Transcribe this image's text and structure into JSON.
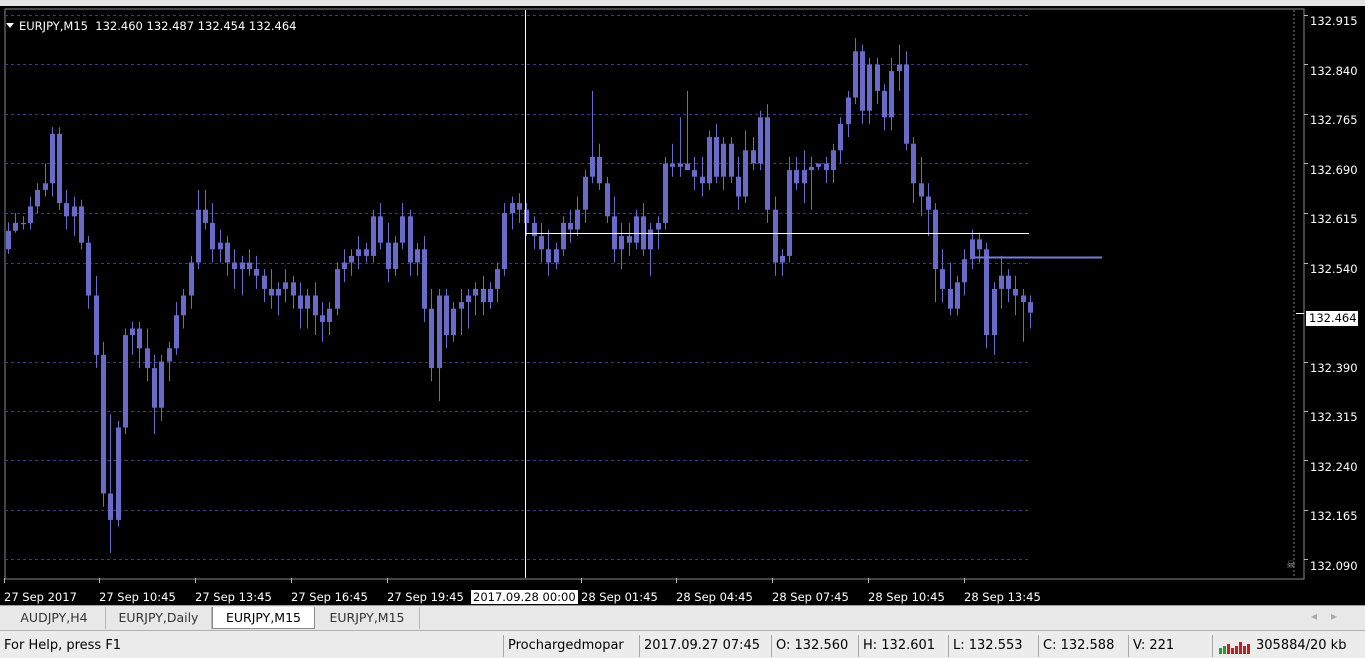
{
  "chart_header": {
    "symbol": "EURJPY,M15",
    "ohlc": "132.460 132.487 132.454 132.464"
  },
  "price_axis": [
    "132.915",
    "132.840",
    "132.765",
    "132.690",
    "132.615",
    "132.540",
    "132.464",
    "132.390",
    "132.315",
    "132.240",
    "132.165",
    "132.090"
  ],
  "current_price_label": "132.464",
  "time_axis": [
    "27 Sep 2017",
    "27 Sep 10:45",
    "27 Sep 13:45",
    "27 Sep 16:45",
    "27 Sep 19:45",
    "28 Sep 01:45",
    "28 Sep 04:45",
    "28 Sep 07:45",
    "28 Sep 10:45",
    "28 Sep 13:45"
  ],
  "crosshair_date": "2017.09.28 00:00",
  "tabs": [
    {
      "label": "AUDJPY,H4",
      "active": false
    },
    {
      "label": "EURJPY,Daily",
      "active": false
    },
    {
      "label": "EURJPY,M15",
      "active": true
    },
    {
      "label": "EURJPY,M15",
      "active": false
    }
  ],
  "status": {
    "help": "For Help, press F1",
    "profile": "Prochargedmopar",
    "datetime": "2017.09.27 07:45",
    "open": "O: 132.560",
    "high": "H: 132.601",
    "low": "L: 132.553",
    "close": "C: 132.588",
    "volume": "V: 221",
    "traffic": "305884/20 kb"
  },
  "colors": {
    "background": "#000000",
    "bull": "#6a6ac8",
    "bear": "#6a6ac8",
    "doji": "#22cc22",
    "grid": "#3a3a8a",
    "crosshair": "#ffffff",
    "price_line": "#7a7ad8"
  },
  "chart_data": {
    "type": "candlestick",
    "symbol": "EURJPY",
    "timeframe": "M15",
    "ylim": [
      132.075,
      132.925
    ],
    "grid": true,
    "y_ticks": [
      132.915,
      132.84,
      132.765,
      132.69,
      132.615,
      132.54,
      132.464,
      132.39,
      132.315,
      132.24,
      132.165,
      132.09
    ],
    "x_ticks": [
      "27 Sep 2017",
      "27 Sep 10:45",
      "27 Sep 13:45",
      "27 Sep 16:45",
      "27 Sep 19:45",
      "28 Sep 01:45",
      "28 Sep 04:45",
      "28 Sep 07:45",
      "28 Sep 10:45",
      "28 Sep 13:45"
    ],
    "last_price": 132.464,
    "horizontal_levels": [
      132.584,
      132.548
    ],
    "ohlc": [
      [
        132.56,
        132.601,
        132.553,
        132.588
      ],
      [
        132.588,
        132.615,
        132.585,
        132.6
      ],
      [
        132.6,
        132.61,
        132.59,
        132.598
      ],
      [
        132.6,
        132.64,
        132.59,
        132.625
      ],
      [
        132.625,
        132.66,
        132.615,
        132.65
      ],
      [
        132.65,
        132.69,
        132.64,
        132.66
      ],
      [
        132.66,
        132.745,
        132.64,
        132.735
      ],
      [
        132.735,
        132.745,
        132.62,
        132.63
      ],
      [
        132.63,
        132.65,
        132.59,
        132.61
      ],
      [
        132.61,
        132.64,
        132.58,
        132.625
      ],
      [
        132.625,
        132.635,
        132.56,
        132.57
      ],
      [
        132.57,
        132.58,
        132.47,
        132.49
      ],
      [
        132.49,
        132.52,
        132.38,
        132.4
      ],
      [
        132.4,
        132.42,
        132.17,
        132.19
      ],
      [
        132.19,
        132.31,
        132.1,
        132.15
      ],
      [
        132.15,
        132.3,
        132.14,
        132.29
      ],
      [
        132.29,
        132.44,
        132.28,
        132.43
      ],
      [
        132.43,
        132.45,
        132.4,
        132.44
      ],
      [
        132.44,
        132.45,
        132.38,
        132.41
      ],
      [
        132.41,
        132.44,
        132.36,
        132.38
      ],
      [
        132.38,
        132.4,
        132.28,
        132.32
      ],
      [
        132.32,
        132.4,
        132.3,
        132.39
      ],
      [
        132.39,
        132.42,
        132.36,
        132.41
      ],
      [
        132.41,
        132.48,
        132.4,
        132.46
      ],
      [
        132.46,
        132.5,
        132.44,
        132.49
      ],
      [
        132.49,
        132.55,
        132.47,
        132.54
      ],
      [
        132.54,
        132.65,
        132.53,
        132.62
      ],
      [
        132.62,
        132.65,
        132.59,
        132.6
      ],
      [
        132.6,
        132.63,
        132.54,
        132.56
      ],
      [
        132.56,
        132.59,
        132.54,
        132.57
      ],
      [
        132.57,
        132.58,
        132.52,
        132.54
      ],
      [
        132.54,
        132.56,
        132.5,
        132.53
      ],
      [
        132.53,
        132.55,
        132.49,
        132.54
      ],
      [
        132.54,
        132.56,
        132.52,
        132.53
      ],
      [
        132.53,
        132.55,
        132.5,
        132.52
      ],
      [
        132.52,
        132.53,
        132.48,
        132.5
      ],
      [
        132.5,
        132.53,
        132.47,
        132.49
      ],
      [
        132.49,
        132.51,
        132.46,
        132.5
      ],
      [
        132.5,
        132.53,
        132.48,
        132.51
      ],
      [
        132.51,
        132.52,
        132.47,
        132.49
      ],
      [
        132.49,
        132.51,
        132.44,
        132.47
      ],
      [
        132.47,
        132.5,
        132.44,
        132.49
      ],
      [
        132.49,
        132.51,
        132.43,
        132.46
      ],
      [
        132.46,
        132.48,
        132.42,
        132.45
      ],
      [
        132.45,
        132.48,
        132.43,
        132.47
      ],
      [
        132.47,
        132.54,
        132.46,
        132.53
      ],
      [
        132.53,
        132.56,
        132.51,
        132.54
      ],
      [
        132.54,
        132.56,
        132.52,
        132.55
      ],
      [
        132.55,
        132.58,
        132.53,
        132.56
      ],
      [
        132.56,
        132.57,
        132.54,
        132.55
      ],
      [
        132.55,
        132.62,
        132.54,
        132.61
      ],
      [
        132.61,
        132.63,
        132.56,
        132.57
      ],
      [
        132.57,
        132.6,
        132.51,
        132.53
      ],
      [
        132.53,
        132.58,
        132.52,
        132.57
      ],
      [
        132.57,
        132.63,
        132.56,
        132.61
      ],
      [
        132.61,
        132.62,
        132.52,
        132.54
      ],
      [
        132.54,
        132.57,
        132.52,
        132.56
      ],
      [
        132.56,
        132.58,
        132.45,
        132.47
      ],
      [
        132.47,
        132.5,
        132.36,
        132.38
      ],
      [
        132.38,
        132.5,
        132.33,
        132.49
      ],
      [
        132.49,
        132.5,
        132.41,
        132.43
      ],
      [
        132.43,
        132.48,
        132.42,
        132.47
      ],
      [
        132.47,
        132.5,
        132.43,
        132.48
      ],
      [
        132.48,
        132.5,
        132.44,
        132.49
      ],
      [
        132.49,
        132.51,
        132.46,
        132.5
      ],
      [
        132.5,
        132.52,
        132.46,
        132.48
      ],
      [
        132.48,
        132.51,
        132.47,
        132.5
      ],
      [
        132.5,
        132.54,
        132.48,
        132.53
      ],
      [
        132.53,
        132.63,
        132.52,
        132.615
      ],
      [
        132.615,
        132.64,
        132.59,
        132.63
      ],
      [
        132.63,
        132.645,
        132.6,
        132.62
      ],
      [
        132.62,
        132.63,
        132.58,
        132.6
      ],
      [
        132.6,
        132.61,
        132.56,
        132.58
      ],
      [
        132.58,
        132.6,
        132.54,
        132.56
      ],
      [
        132.56,
        132.59,
        132.52,
        132.54
      ],
      [
        132.54,
        132.57,
        132.53,
        132.56
      ],
      [
        132.56,
        132.61,
        132.55,
        132.6
      ],
      [
        132.6,
        132.62,
        132.57,
        132.59
      ],
      [
        132.59,
        132.64,
        132.58,
        132.62
      ],
      [
        132.62,
        132.68,
        132.6,
        132.67
      ],
      [
        132.67,
        132.8,
        132.66,
        132.7
      ],
      [
        132.7,
        132.72,
        132.65,
        132.66
      ],
      [
        132.66,
        132.67,
        132.6,
        132.61
      ],
      [
        132.61,
        132.64,
        132.54,
        132.56
      ],
      [
        132.56,
        132.6,
        132.53,
        132.58
      ],
      [
        132.58,
        132.6,
        132.55,
        132.57
      ],
      [
        132.57,
        132.62,
        132.56,
        132.61
      ],
      [
        132.61,
        132.63,
        132.55,
        132.56
      ],
      [
        132.56,
        132.6,
        132.52,
        132.59
      ],
      [
        132.59,
        132.61,
        132.56,
        132.6
      ],
      [
        132.6,
        132.7,
        132.59,
        132.69
      ],
      [
        132.69,
        132.72,
        132.67,
        132.685
      ],
      [
        132.685,
        132.76,
        132.67,
        132.69
      ],
      [
        132.69,
        132.8,
        132.68,
        132.68
      ],
      [
        132.68,
        132.7,
        132.65,
        132.67
      ],
      [
        132.67,
        132.7,
        132.64,
        132.66
      ],
      [
        132.66,
        132.74,
        132.65,
        132.73
      ],
      [
        132.73,
        132.75,
        132.66,
        132.67
      ],
      [
        132.67,
        132.73,
        132.65,
        132.72
      ],
      [
        132.72,
        132.73,
        132.66,
        132.67
      ],
      [
        132.67,
        132.7,
        132.62,
        132.64
      ],
      [
        132.64,
        132.74,
        132.63,
        132.71
      ],
      [
        132.71,
        132.73,
        132.68,
        132.69
      ],
      [
        132.69,
        132.77,
        132.68,
        132.76
      ],
      [
        132.76,
        132.78,
        132.6,
        132.62
      ],
      [
        132.62,
        132.64,
        132.52,
        132.54
      ],
      [
        132.54,
        132.56,
        132.52,
        132.55
      ],
      [
        132.55,
        132.7,
        132.54,
        132.68
      ],
      [
        132.68,
        132.7,
        132.65,
        132.66
      ],
      [
        132.66,
        132.71,
        132.63,
        132.68
      ],
      [
        132.68,
        132.7,
        132.62,
        132.685
      ],
      [
        132.685,
        132.69,
        132.68,
        132.69
      ],
      [
        132.69,
        132.7,
        132.66,
        132.68
      ],
      [
        132.68,
        132.72,
        132.66,
        132.71
      ],
      [
        132.71,
        132.76,
        132.69,
        132.75
      ],
      [
        132.75,
        132.8,
        132.73,
        132.79
      ],
      [
        132.79,
        132.88,
        132.78,
        132.86
      ],
      [
        132.86,
        132.87,
        132.75,
        132.77
      ],
      [
        132.77,
        132.85,
        132.75,
        132.84
      ],
      [
        132.84,
        132.85,
        132.78,
        132.8
      ],
      [
        132.8,
        132.81,
        132.74,
        132.76
      ],
      [
        132.76,
        132.85,
        132.74,
        132.83
      ],
      [
        132.83,
        132.87,
        132.8,
        132.84
      ],
      [
        132.84,
        132.86,
        132.71,
        132.72
      ],
      [
        132.72,
        132.73,
        132.63,
        132.66
      ],
      [
        132.66,
        132.7,
        132.61,
        132.64
      ],
      [
        132.64,
        132.66,
        132.58,
        132.62
      ],
      [
        132.62,
        132.63,
        132.48,
        132.53
      ],
      [
        132.53,
        132.56,
        132.48,
        132.5
      ],
      [
        132.5,
        132.54,
        132.46,
        132.47
      ],
      [
        132.47,
        132.52,
        132.46,
        132.51
      ],
      [
        132.51,
        132.56,
        132.49,
        132.545
      ],
      [
        132.545,
        132.59,
        132.53,
        132.575
      ],
      [
        132.575,
        132.585,
        132.54,
        132.56
      ],
      [
        132.56,
        132.57,
        132.41,
        132.43
      ],
      [
        132.43,
        132.51,
        132.4,
        132.5
      ],
      [
        132.5,
        132.55,
        132.47,
        132.52
      ],
      [
        132.52,
        132.53,
        132.48,
        132.5
      ],
      [
        132.5,
        132.52,
        132.46,
        132.49
      ],
      [
        132.49,
        132.5,
        132.42,
        132.48
      ],
      [
        132.48,
        132.49,
        132.44,
        132.464
      ]
    ]
  }
}
